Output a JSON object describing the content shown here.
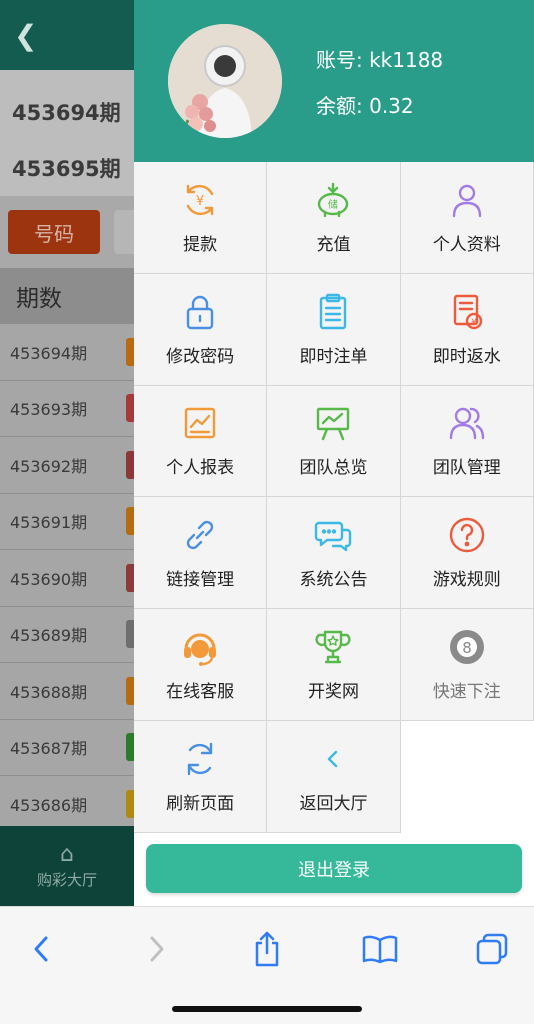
{
  "background": {
    "draws": [
      {
        "period": "453694期"
      },
      {
        "period": "453695期"
      }
    ],
    "tab_active": "号码",
    "table_header": "期数",
    "rows": [
      {
        "period": "453694期",
        "color": "#b86a10"
      },
      {
        "period": "453693期",
        "color": "#a43a3a"
      },
      {
        "period": "453692期",
        "color": "#8c3838"
      },
      {
        "period": "453691期",
        "color": "#b56c10"
      },
      {
        "period": "453690期",
        "color": "#8c3a3a"
      },
      {
        "period": "453689期",
        "color": "#6e6e6e"
      },
      {
        "period": "453688期",
        "color": "#b56c10"
      },
      {
        "period": "453687期",
        "color": "#2c7a2c"
      },
      {
        "period": "453686期",
        "color": "#b08a10"
      }
    ],
    "footer_label": "购彩大厅"
  },
  "drawer": {
    "account": "账号: kk1188",
    "balance": "余额: 0.32",
    "menu": [
      {
        "label": "提款",
        "icon": "withdraw-icon",
        "color": "#f29a3a"
      },
      {
        "label": "充值",
        "icon": "piggy-bank-icon",
        "color": "#57b94a"
      },
      {
        "label": "个人资料",
        "icon": "user-icon",
        "color": "#a27be6"
      },
      {
        "label": "修改密码",
        "icon": "lock-icon",
        "color": "#4a90e2"
      },
      {
        "label": "即时注单",
        "icon": "clipboard-icon",
        "color": "#3bb8e8"
      },
      {
        "label": "即时返水",
        "icon": "rebate-icon",
        "color": "#ee5a3c"
      },
      {
        "label": "个人报表",
        "icon": "report-icon",
        "color": "#f29a3a"
      },
      {
        "label": "团队总览",
        "icon": "presentation-icon",
        "color": "#57b94a"
      },
      {
        "label": "团队管理",
        "icon": "team-icon",
        "color": "#a27be6"
      },
      {
        "label": "链接管理",
        "icon": "link-icon",
        "color": "#4a90e2"
      },
      {
        "label": "系统公告",
        "icon": "chat-icon",
        "color": "#3bb8e8"
      },
      {
        "label": "游戏规则",
        "icon": "help-icon",
        "color": "#ee5a3c"
      },
      {
        "label": "在线客服",
        "icon": "headset-icon",
        "color": "#f29a3a"
      },
      {
        "label": "开奖网",
        "icon": "trophy-icon",
        "color": "#57b94a"
      },
      {
        "label": "快速下注",
        "icon": "eight-ball-icon",
        "color": "#8a8a8a"
      },
      {
        "label": "刷新页面",
        "icon": "refresh-icon",
        "color": "#4a90e2"
      },
      {
        "label": "返回大厅",
        "icon": "back-chevron-icon",
        "color": "#3bb8e8"
      }
    ],
    "logout_label": "退出登录"
  },
  "toolbar": {
    "items": [
      "back-icon",
      "forward-icon",
      "share-icon",
      "bookmarks-icon",
      "tabs-icon"
    ]
  }
}
